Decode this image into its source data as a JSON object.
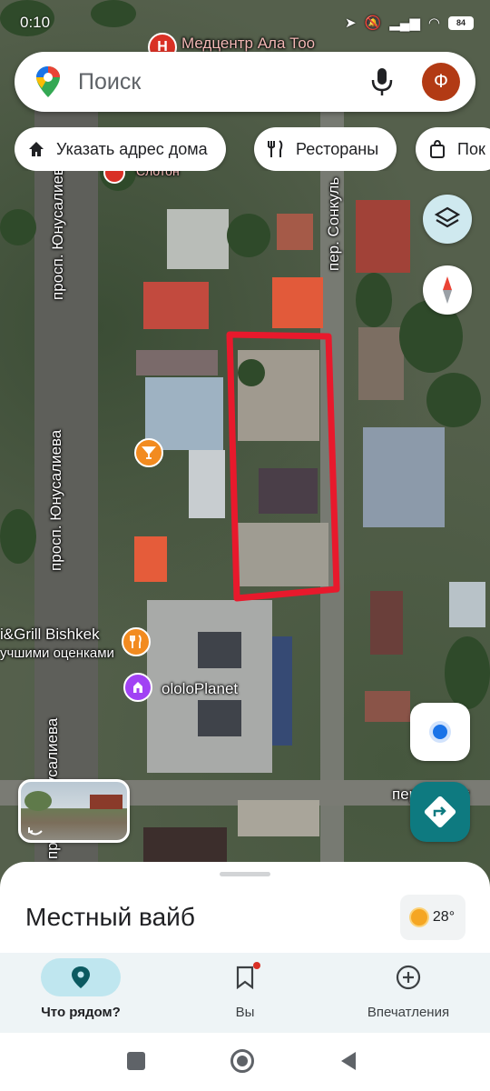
{
  "status": {
    "time": "0:10",
    "battery": "84",
    "icons": [
      "navigation-icon",
      "mute-icon",
      "signal-icon",
      "wifi-icon",
      "battery-icon"
    ]
  },
  "search": {
    "placeholder": "Поиск",
    "avatar_letter": "Ф"
  },
  "chips": [
    {
      "label": "Указать адрес дома",
      "icon": "home-icon"
    },
    {
      "label": "Рестораны",
      "icon": "restaurant-icon"
    },
    {
      "label": "Пок",
      "icon": "shopping-bag-icon"
    }
  ],
  "map": {
    "labels": {
      "poi_top": "Медцентр Ала Тоо",
      "street_left_top": "просп. Юнусалиева",
      "street_left_mid": "просп. Юнусалиева",
      "street_left_bottom": "просп. Юнусалиева",
      "street_right": "пер. Сонкуль",
      "street_bottom_right": "пер. Сонку",
      "poi_grill": "i&Grill Bishkek",
      "poi_grill_sub": "учшими оценками",
      "poi_planet": "ololoPlanet",
      "poi_partial": "Слотон"
    },
    "colors": {
      "highlight": "#e8192c",
      "hospital": "#d93025",
      "bar": "#f28b20",
      "planet": "#a142f4"
    }
  },
  "sheet": {
    "title": "Местный вайб",
    "temperature": "28°"
  },
  "bottom_nav": [
    {
      "label": "Что рядом?",
      "icon": "explore-pin-icon",
      "active": true
    },
    {
      "label": "Вы",
      "icon": "bookmark-icon",
      "active": false
    },
    {
      "label": "Впечатления",
      "icon": "add-circle-icon",
      "active": false
    }
  ]
}
